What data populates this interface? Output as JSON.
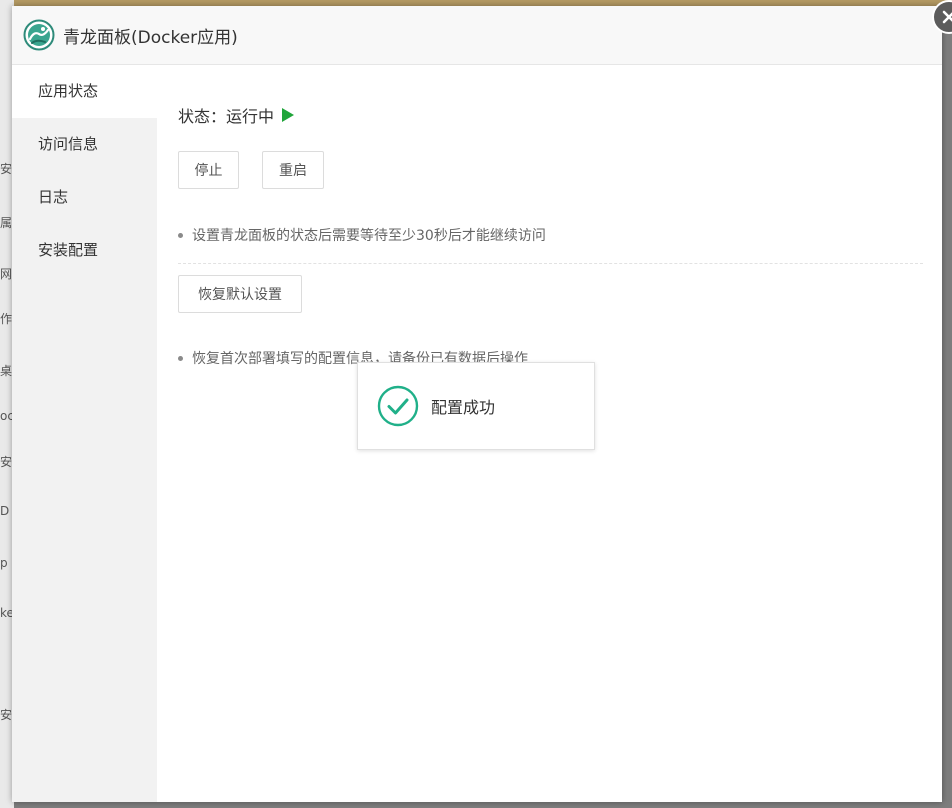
{
  "background": {
    "fragments": [
      "安",
      "属",
      "网",
      "作",
      "桌",
      "oc",
      "安",
      "D",
      "p",
      "ke",
      "安"
    ]
  },
  "dialog": {
    "title": "青龙面板(Docker应用)",
    "logo_icon": "qinglong-logo-icon",
    "close_icon": "close-icon"
  },
  "sidebar": {
    "items": [
      {
        "label": "应用状态",
        "active": true
      },
      {
        "label": "访问信息",
        "active": false
      },
      {
        "label": "日志",
        "active": false
      },
      {
        "label": "安装配置",
        "active": false
      }
    ]
  },
  "main": {
    "status_label": "状态：",
    "status_value": "运行中",
    "status_icon": "play-icon",
    "status_color": "#20a53a",
    "stop_label": "停止",
    "restart_label": "重启",
    "note_wait": "设置青龙面板的状态后需要等待至少30秒后才能继续访问",
    "restore_label": "恢复默认设置",
    "note_restore": "恢复首次部署填写的配置信息，请备份已有数据后操作"
  },
  "toast": {
    "message": "配置成功",
    "icon": "check-circle-icon",
    "color": "#20b089"
  }
}
